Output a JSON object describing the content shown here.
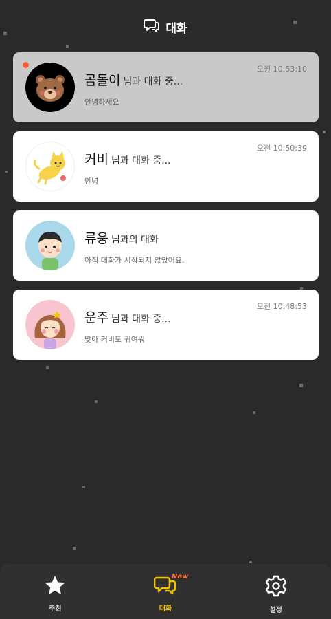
{
  "header": {
    "title": "대화",
    "icon": "chat-bubbles-icon"
  },
  "colors": {
    "background": "#2a2a2a",
    "accent": "#f5c400",
    "unread": "#ff5a36",
    "badge": "#ff6b3d"
  },
  "chats": [
    {
      "name": "곰돌이",
      "status": "님과 대화 중...",
      "time": "오전 10:53:10",
      "preview": "안녕하세요",
      "avatar": "bear-avatar-icon",
      "unread": true,
      "selected": true
    },
    {
      "name": "커비",
      "status": "님과 대화 중...",
      "time": "오전 10:50:39",
      "preview": "안녕",
      "avatar": "yellow-cat-avatar-icon",
      "unread": false,
      "selected": false
    },
    {
      "name": "류웅",
      "status": "님과의 대화",
      "time": "",
      "preview": "아직 대화가 시작되지 않았어요.",
      "avatar": "boy-avatar-icon",
      "unread": false,
      "selected": false
    },
    {
      "name": "운주",
      "status": "님과 대화 중...",
      "time": "오전 10:48:53",
      "preview": "맞아 커비도 귀여워",
      "avatar": "girl-avatar-icon",
      "unread": false,
      "selected": false
    }
  ],
  "nav": [
    {
      "label": "추천",
      "icon": "star-icon",
      "active": false
    },
    {
      "label": "대화",
      "icon": "chat-bubbles-icon",
      "active": true,
      "badge": "New"
    },
    {
      "label": "설정",
      "icon": "gear-icon",
      "active": false
    }
  ]
}
